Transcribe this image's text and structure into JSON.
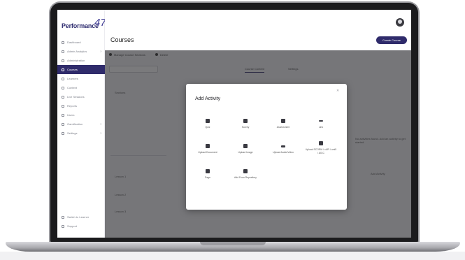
{
  "sidebar": {
    "logo_small": "",
    "logo_text": "Performance",
    "items": [
      {
        "label": "Dashboard",
        "active": false
      },
      {
        "label": "Admin Analytics",
        "active": false
      },
      {
        "label": "Administration",
        "active": false
      },
      {
        "label": "Courses",
        "active": true
      },
      {
        "label": "Learners",
        "active": false
      },
      {
        "label": "Content",
        "active": false
      },
      {
        "label": "Live Sessions",
        "active": false
      },
      {
        "label": "Reports",
        "active": false
      },
      {
        "label": "Users",
        "active": false
      },
      {
        "label": "Gamification",
        "active": false
      },
      {
        "label": "Settings",
        "active": false
      }
    ],
    "bottom_items": [
      {
        "label": "Switch to Learner"
      },
      {
        "label": "Support"
      }
    ]
  },
  "header": {
    "page_title": "Courses",
    "primary_button": "Create Course"
  },
  "content": {
    "toolbar": [
      {
        "label": "Manage Course Sections"
      },
      {
        "label": "Delete"
      }
    ],
    "tabs": [
      {
        "label": "Course Content",
        "active": true
      },
      {
        "label": "Settings",
        "active": false
      }
    ],
    "section_label": "Sections",
    "side_note": "No activities found. Add an activity to get started.",
    "link_text": "Add Activity",
    "rows": [
      "Lesson 1",
      "Lesson 2",
      "Lesson 3"
    ]
  },
  "modal": {
    "title": "Add Activity",
    "close_icon": "close-icon",
    "activities": [
      {
        "label": "Quiz",
        "icon": "quiz-icon"
      },
      {
        "label": "Survey",
        "icon": "survey-icon"
      },
      {
        "label": "Assessment",
        "icon": "assessment-icon"
      },
      {
        "label": "Link",
        "icon": "link-icon"
      },
      {
        "label": "Upload Document",
        "icon": "document-icon"
      },
      {
        "label": "Upload Image",
        "icon": "image-icon"
      },
      {
        "label": "Upload Audio/Video",
        "icon": "video-icon"
      },
      {
        "label": "Upload SCORM / xAPI / cmi5 / AICC",
        "icon": "package-icon"
      },
      {
        "label": "Page",
        "icon": "page-icon"
      },
      {
        "label": "Add From Repository",
        "icon": "repository-icon"
      }
    ]
  },
  "colors": {
    "brand": "#2f2b6b",
    "overlay": "#28282c"
  }
}
